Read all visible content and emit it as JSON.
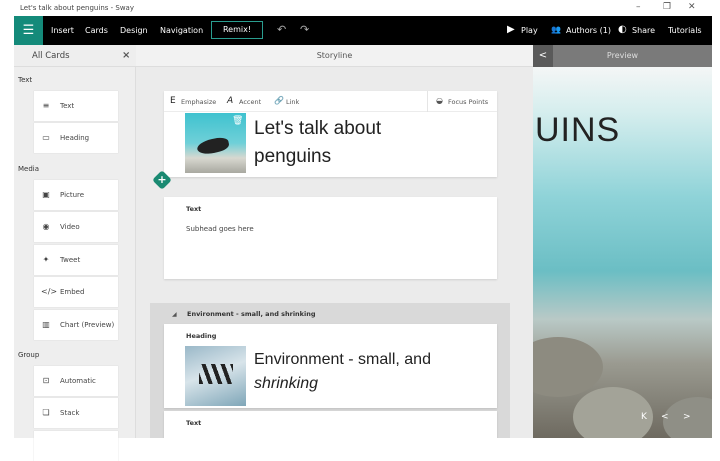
{
  "window": {
    "title": "Let's talk about penguins - Sway",
    "minimize": "–",
    "restore": "❐",
    "close": "✕"
  },
  "toolbar": {
    "menu_icon": "hamburger-icon",
    "insert": "Insert",
    "cards": "Cards",
    "design": "Design",
    "navigation": "Navigation",
    "remix": "Remix!",
    "play": "Play",
    "authors": "Authors (1)",
    "share": "Share",
    "tutorials": "Tutorials"
  },
  "left_panel": {
    "title": "All Cards",
    "close": "×",
    "sections": [
      {
        "label": "Text",
        "items": [
          {
            "icon": "text-icon",
            "glyph": "≡",
            "label": "Text"
          },
          {
            "icon": "heading-icon",
            "glyph": "▭",
            "label": "Heading"
          }
        ]
      },
      {
        "label": "Media",
        "items": [
          {
            "icon": "picture-icon",
            "glyph": "▣",
            "label": "Picture"
          },
          {
            "icon": "video-icon",
            "glyph": "◉",
            "label": "Video"
          },
          {
            "icon": "tweet-icon",
            "glyph": "✦",
            "label": "Tweet"
          },
          {
            "icon": "embed-icon",
            "glyph": "</>",
            "label": "Embed"
          },
          {
            "icon": "chart-icon",
            "glyph": "▥",
            "label": "Chart (Preview)"
          }
        ]
      },
      {
        "label": "Group",
        "items": [
          {
            "icon": "automatic-icon",
            "glyph": "⊡",
            "label": "Automatic"
          },
          {
            "icon": "stack-icon",
            "glyph": "❏",
            "label": "Stack"
          }
        ]
      }
    ]
  },
  "storyline": {
    "title": "Storyline",
    "format_bar": {
      "emphasize": "Emphasize",
      "accent": "Accent",
      "link": "Link",
      "focus_points": "Focus Points"
    },
    "title_card": {
      "text_line1": "Let's talk about",
      "text_line2": "penguins"
    },
    "text_card": {
      "label": "Text",
      "body": "Subhead goes here"
    },
    "section": {
      "title": "Environment - small, and shrinking",
      "heading_card": {
        "label": "Heading",
        "text_line1": "Environment - small, and",
        "text_line2": "shrinking"
      },
      "text_card": {
        "label": "Text"
      }
    }
  },
  "preview": {
    "title": "Preview",
    "back": "<",
    "big_text": "UINS",
    "nav_first": "K",
    "nav_prev": "<",
    "nav_next": ">"
  }
}
